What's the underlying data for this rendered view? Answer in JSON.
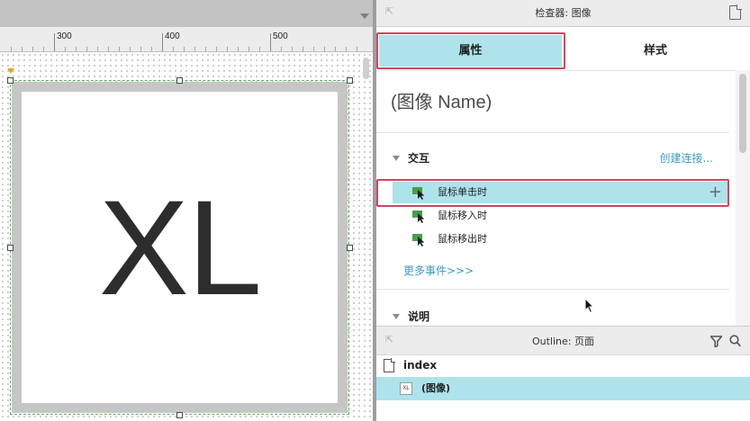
{
  "canvas": {
    "ruler_labels": [
      "300",
      "400",
      "500"
    ],
    "image_placeholder_text": "XL"
  },
  "inspector": {
    "title": "检查器: 图像",
    "tabs": {
      "properties": "属性",
      "style": "样式"
    },
    "widget_name": "(图像 Name)",
    "interactions": {
      "section_title": "交互",
      "create_link": "创建连接...",
      "events": [
        {
          "label": "鼠标单击时",
          "selected": true
        },
        {
          "label": "鼠标移入时",
          "selected": false
        },
        {
          "label": "鼠标移出时",
          "selected": false
        }
      ],
      "add_symbol": "+",
      "more_events": "更多事件>>>"
    },
    "notes": {
      "section_title": "说明"
    }
  },
  "outline": {
    "title": "Outline: 页面",
    "items": [
      {
        "label": "index",
        "type": "page"
      },
      {
        "label": "(图像)",
        "type": "image",
        "icon_text": "XL",
        "selected": true
      }
    ]
  },
  "colors": {
    "selection_bg": "#aee3ec",
    "highlight_border": "#d2455f",
    "link": "#3a9cc6",
    "event_icon": "#45a04a"
  },
  "icons": {
    "event": "lightning-cursor-icon",
    "page": "page-icon",
    "filter": "filter-icon",
    "search": "search-icon"
  }
}
